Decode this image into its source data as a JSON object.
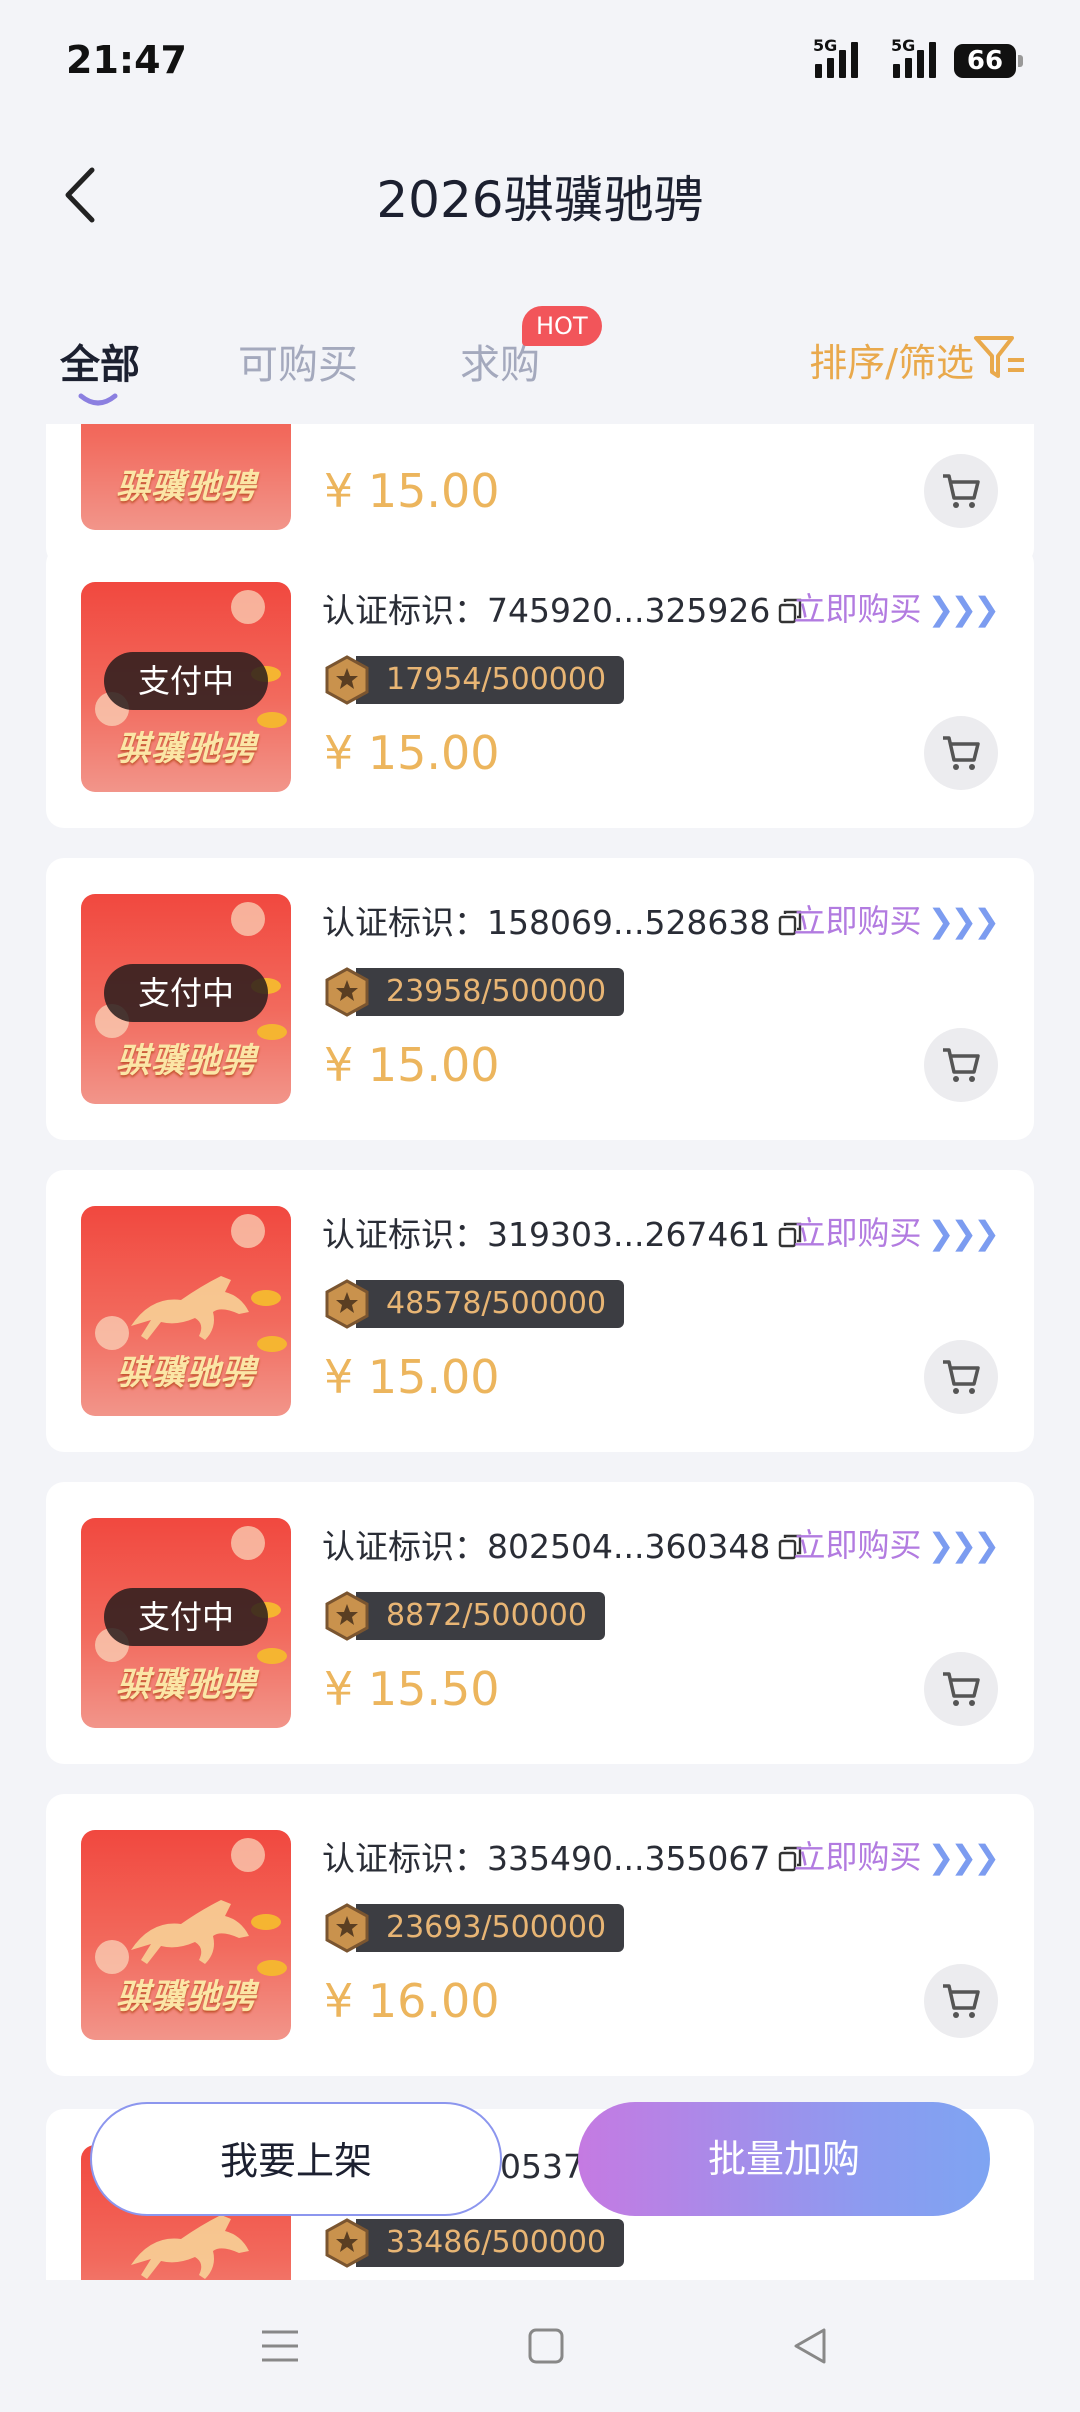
{
  "status_bar": {
    "time": "21:47",
    "network1": "5G",
    "network2": "5G",
    "battery": "66"
  },
  "header": {
    "title": "2026骐骥驰骋"
  },
  "tabs": [
    {
      "label": "全部",
      "active": true
    },
    {
      "label": "可购买",
      "active": false
    },
    {
      "label": "求购",
      "active": false
    }
  ],
  "hot_badge": "HOT",
  "sort_filter": "排序/筛选",
  "partial_top": {
    "price": "¥ 15.00"
  },
  "items": [
    {
      "cert_label": "认证标识：",
      "cert_id": "745920...325926",
      "buy_label": "立即购买",
      "count": "17954/500000",
      "price": "¥ 15.00",
      "status": "支付中",
      "image_text": "骐骥驰骋"
    },
    {
      "cert_label": "认证标识：",
      "cert_id": "158069...528638",
      "buy_label": "立即购买",
      "count": "23958/500000",
      "price": "¥ 15.00",
      "status": "支付中",
      "image_text": "骐骥驰骋"
    },
    {
      "cert_label": "认证标识：",
      "cert_id": "319303...267461",
      "buy_label": "立即购买",
      "count": "48578/500000",
      "price": "¥ 15.00",
      "status": "",
      "image_text": "骐骥驰骋"
    },
    {
      "cert_label": "认证标识：",
      "cert_id": "802504...360348",
      "buy_label": "立即购买",
      "count": "8872/500000",
      "price": "¥ 15.50",
      "status": "支付中",
      "image_text": "骐骥驰骋"
    },
    {
      "cert_label": "认证标识：",
      "cert_id": "335490...355067",
      "buy_label": "立即购买",
      "count": "23693/500000",
      "price": "¥ 16.00",
      "status": "",
      "image_text": "骐骥驰骋"
    }
  ],
  "partial_bottom": {
    "cert_fragment": "0537",
    "count": "33486/500000"
  },
  "buttons": {
    "list_item": "我要上架",
    "batch_add": "批量加购"
  },
  "icons": {
    "back": "chevron-left-icon",
    "filter": "filter-icon",
    "copy": "copy-icon",
    "cart": "cart-icon",
    "star": "star-hex-icon",
    "nav_menu": "menu-icon",
    "nav_home": "square-icon",
    "nav_back": "triangle-back-icon"
  },
  "colors": {
    "accent_gold": "#ecb55d",
    "buy_purple": "#b27be0",
    "hot_red": "#f2555a"
  }
}
